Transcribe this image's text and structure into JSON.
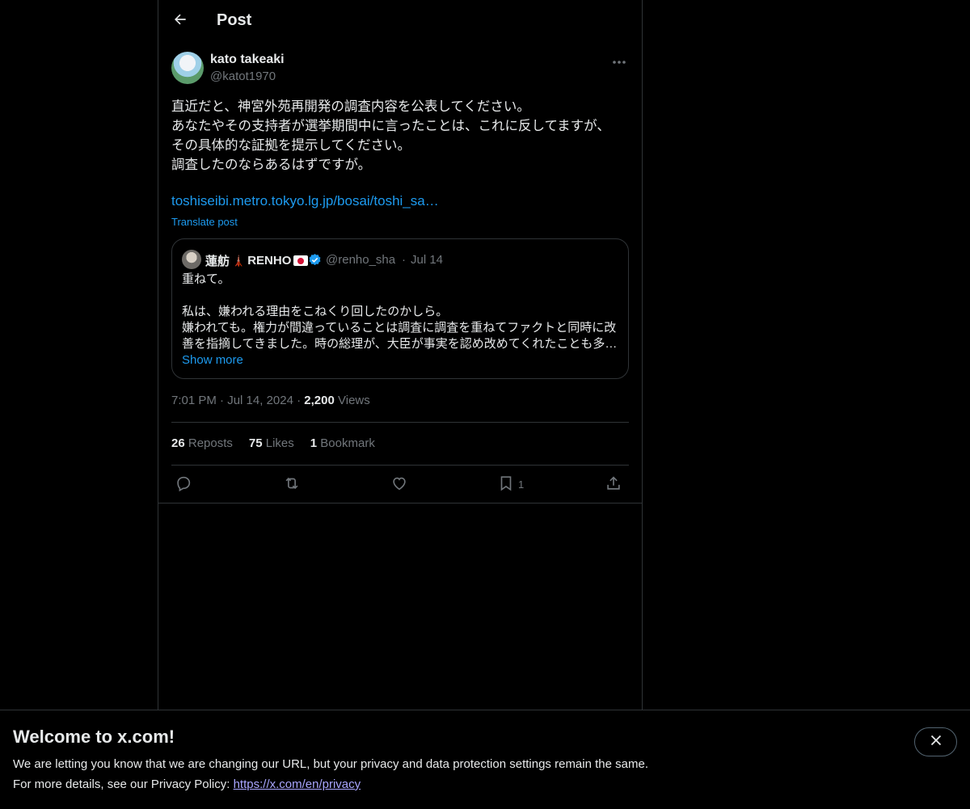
{
  "header": {
    "title": "Post"
  },
  "post": {
    "author_name": "kato takeaki",
    "author_handle": "@katot1970",
    "text": "直近だと、神宮外苑再開発の調査内容を公表してください。\nあなたやその支持者が選挙期間中に言ったことは、これに反してますが、\nその具体的な証拠を提示してください。\n調査したのならあるはずですが。",
    "link": "toshiseibi.metro.tokyo.lg.jp/bosai/toshi_sa…",
    "translate": "Translate post",
    "time": "7:01 PM",
    "date": "Jul 14, 2024",
    "views_count": "2,200",
    "views_label": "Views"
  },
  "quote": {
    "name": "蓮舫",
    "name_suffix": "RENHO",
    "handle": "@renho_sha",
    "date": "Jul 14",
    "text": "重ねて。\n\n私は、嫌われる理由をこねくり回したのかしら。\n嫌われても。権力が間違っていることは調査に調査を重ねてファクトと同時に改善を指摘してきました。時の総理が、大臣が事実を認め改めてくれたことも多…",
    "show_more": "Show more"
  },
  "stats": [
    {
      "count": "26",
      "label": "Reposts"
    },
    {
      "count": "75",
      "label": "Likes"
    },
    {
      "count": "1",
      "label": "Bookmark"
    }
  ],
  "actions": {
    "bookmark_count": "1"
  },
  "banner": {
    "title": "Welcome to x.com!",
    "line1": "We are letting you know that we are changing our URL, but your privacy and data protection settings remain the same.",
    "line2_prefix": "For more details, see our Privacy Policy: ",
    "link": "https://x.com/en/privacy"
  },
  "colors": {
    "accent": "#1d9bf0",
    "muted": "#71767b",
    "border": "#2f3336"
  }
}
